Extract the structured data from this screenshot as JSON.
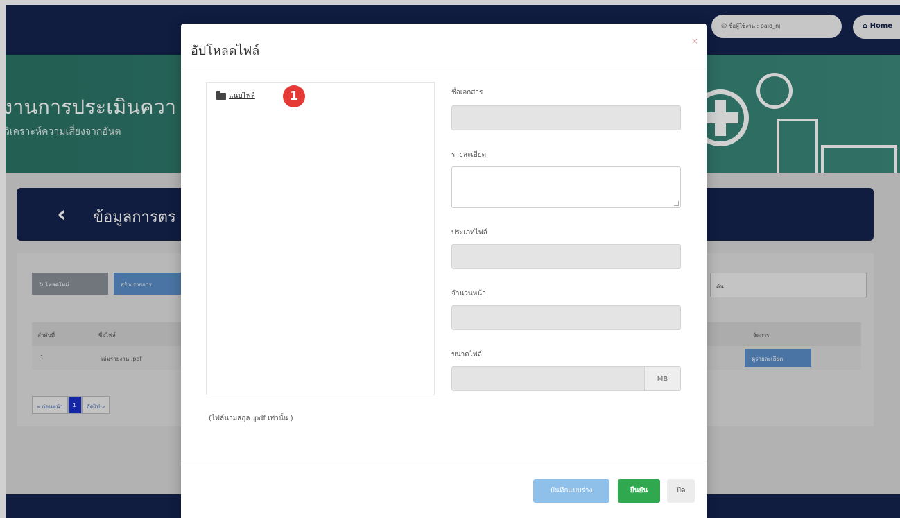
{
  "background": {
    "topbar": {
      "user_label": "ชื่อผู้ใช้งาน : paid_nj",
      "home_label": "Home"
    },
    "banner": {
      "title": "งานการประเมินควา",
      "subtitle": "วิเคราะห์ความเสี่ยงจากอันต"
    },
    "section": {
      "title": "ข้อมูลการตร"
    },
    "toolbar": {
      "reload_label": "โหลดใหม่",
      "other_label": "สร้างรายการ",
      "search_placeholder": "ค้น"
    },
    "table": {
      "headers": {
        "no": "ลำดับที่",
        "name": "ชื่อไฟล์",
        "action": "จัดการ"
      },
      "rows": [
        {
          "no": "1",
          "name": "เล่มรายงาน .pdf",
          "action_label": "ดูรายละเอียด"
        }
      ]
    },
    "pager": {
      "prev": "« ก่อนหน้า",
      "current": "1",
      "next": "ถัดไป »"
    }
  },
  "modal": {
    "title": "อัปโหลดไฟล์",
    "close_icon": "×",
    "file_panel": {
      "folder_label": "แนบไฟล์",
      "step_badge": "1"
    },
    "file_note": "(ไฟล์นามสกุล .pdf เท่านั้น )",
    "fields": {
      "doc_name_label": "ชื่อเอกสาร",
      "detail_label": "รายละเอียด",
      "file_type_label": "ประเภทไฟล์",
      "page_count_label": "จำนวนหน้า",
      "file_size_label": "ขนาดไฟล์",
      "size_unit": "MB"
    },
    "footer": {
      "draft_label": "บันทึกแบบร่าง",
      "confirm_label": "ยืนยัน",
      "close_label": "ปิด"
    }
  },
  "colors": {
    "navy": "#14234f",
    "teal": "#2e7d6e",
    "confirm_green": "#2fa84f",
    "draft_blue": "#8ec0ea",
    "badge_red": "#e53935"
  }
}
